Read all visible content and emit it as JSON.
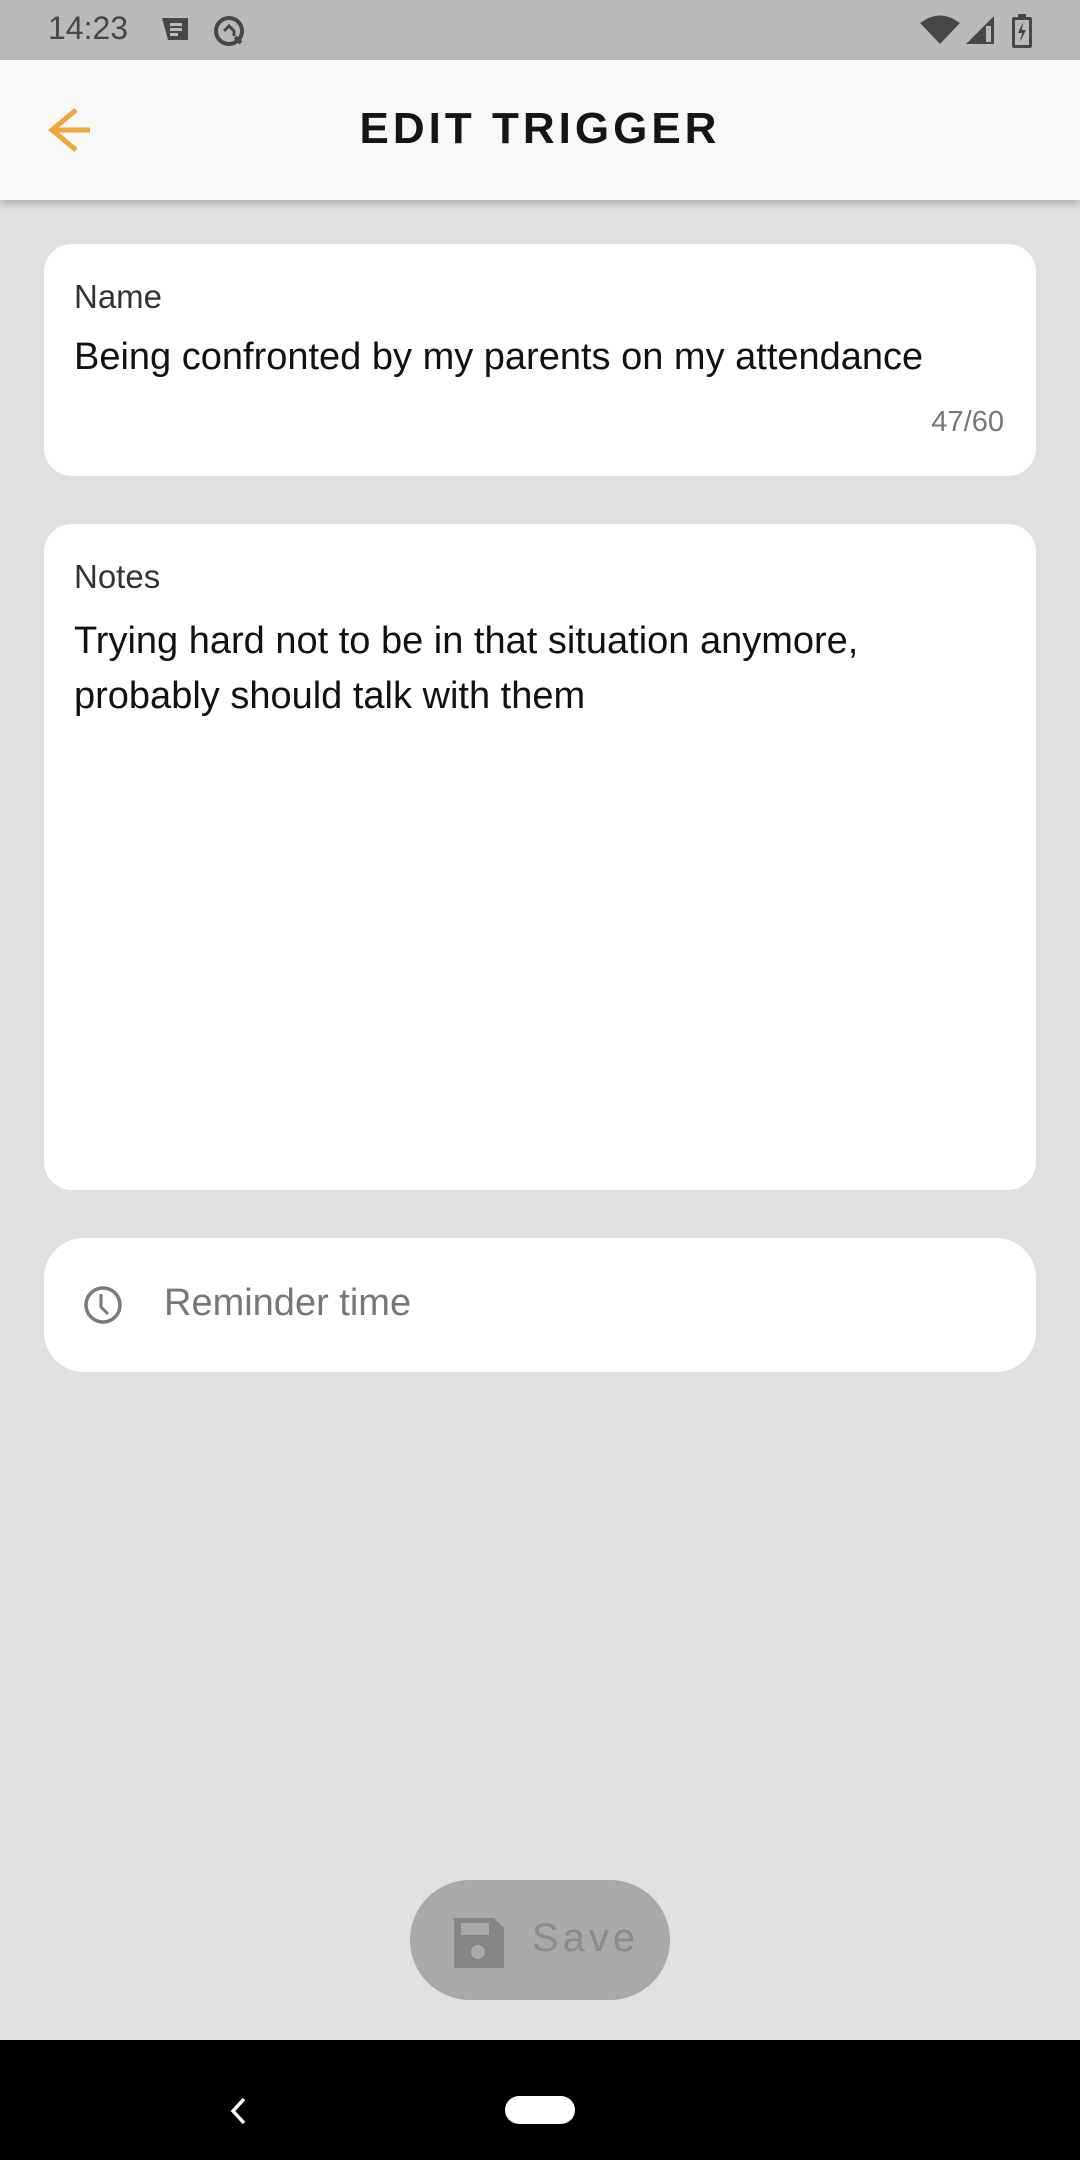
{
  "status_bar": {
    "time": "14:23",
    "icons": [
      "message-icon",
      "data-saver-icon",
      "wifi-icon",
      "signal-icon",
      "battery-charging-icon"
    ]
  },
  "app_bar": {
    "title": "EDIT TRIGGER",
    "back_icon": "arrow-left-icon",
    "accent_color": "#f2a53a"
  },
  "form": {
    "name": {
      "label": "Name",
      "value": "Being confronted by my parents on my attendance",
      "counter": "47/60"
    },
    "notes": {
      "label": "Notes",
      "value": "Trying hard not to be in that situation anymore, probably should talk with them"
    },
    "reminder": {
      "icon": "clock-icon",
      "placeholder": "Reminder time"
    }
  },
  "save_button": {
    "label": "Save",
    "icon": "floppy-disk-icon",
    "state": "disabled"
  },
  "nav_bar": {
    "back_icon": "nav-back-icon",
    "home_icon": "nav-home-pill"
  }
}
